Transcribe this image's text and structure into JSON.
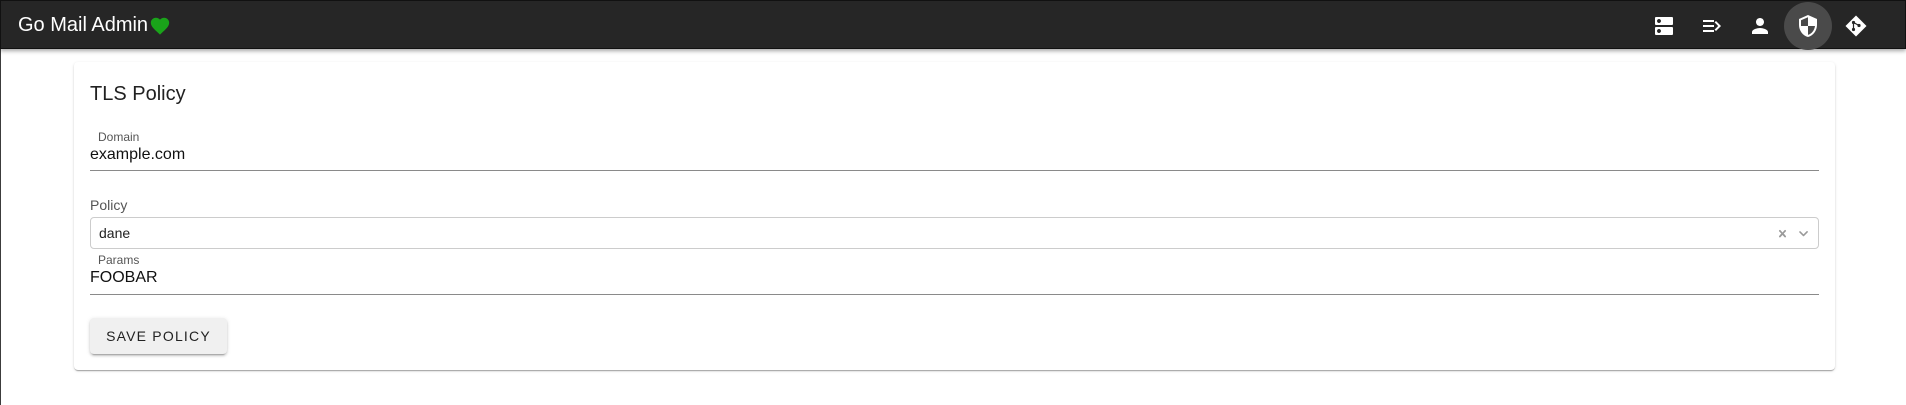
{
  "app": {
    "title": "Go Mail Admin",
    "logo_icon": "heart-icon",
    "logo_color": "#1aa31a"
  },
  "toolbar": {
    "icons": [
      "server-icon",
      "forward-icon",
      "person-icon",
      "security-shield-icon",
      "git-icon"
    ],
    "active_icon": "security-shield-icon"
  },
  "form": {
    "title": "TLS Policy",
    "domain": {
      "label": "Domain",
      "value": "example.com"
    },
    "policy": {
      "label": "Policy",
      "value": "dane"
    },
    "params": {
      "label": "Params",
      "value": "FOOBAR"
    },
    "save_label": "SAVE POLICY"
  }
}
